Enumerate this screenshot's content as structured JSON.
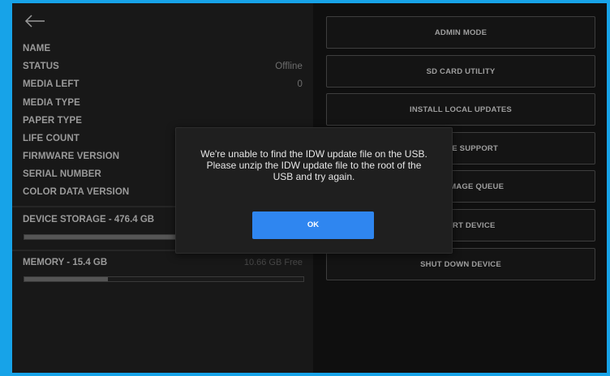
{
  "device_info": {
    "rows": [
      {
        "label": "NAME",
        "value": ""
      },
      {
        "label": "STATUS",
        "value": "Offline"
      },
      {
        "label": "MEDIA LEFT",
        "value": "0"
      },
      {
        "label": "MEDIA TYPE",
        "value": ""
      },
      {
        "label": "PAPER TYPE",
        "value": ""
      },
      {
        "label": "LIFE COUNT",
        "value": ""
      },
      {
        "label": "FIRMWARE VERSION",
        "value": ""
      },
      {
        "label": "SERIAL NUMBER",
        "value": ""
      },
      {
        "label": "COLOR DATA VERSION",
        "value": ""
      }
    ]
  },
  "storage": {
    "title": "DEVICE STORAGE - 476.4 GB",
    "free": "",
    "used_fraction": 0.58
  },
  "memory": {
    "title": "MEMORY - 15.4 GB",
    "free": "10.66 GB Free",
    "used_fraction": 0.3
  },
  "actions": [
    {
      "label": "ADMIN MODE"
    },
    {
      "label": "SD CARD UTILITY"
    },
    {
      "label": "INSTALL LOCAL UPDATES"
    },
    {
      "label": "REMOTE SUPPORT"
    },
    {
      "label": "CLEAR IMAGE QUEUE"
    },
    {
      "label": "RESTART DEVICE"
    },
    {
      "label": "SHUT DOWN DEVICE"
    }
  ],
  "dialog": {
    "message": "We're unable to find the IDW update file on the USB.\nPlease unzip the IDW update file to the root of the\nUSB and try again.",
    "ok_label": "OK"
  },
  "colors": {
    "frame_border": "#17a3e8",
    "ok_button": "#2f86f0"
  }
}
